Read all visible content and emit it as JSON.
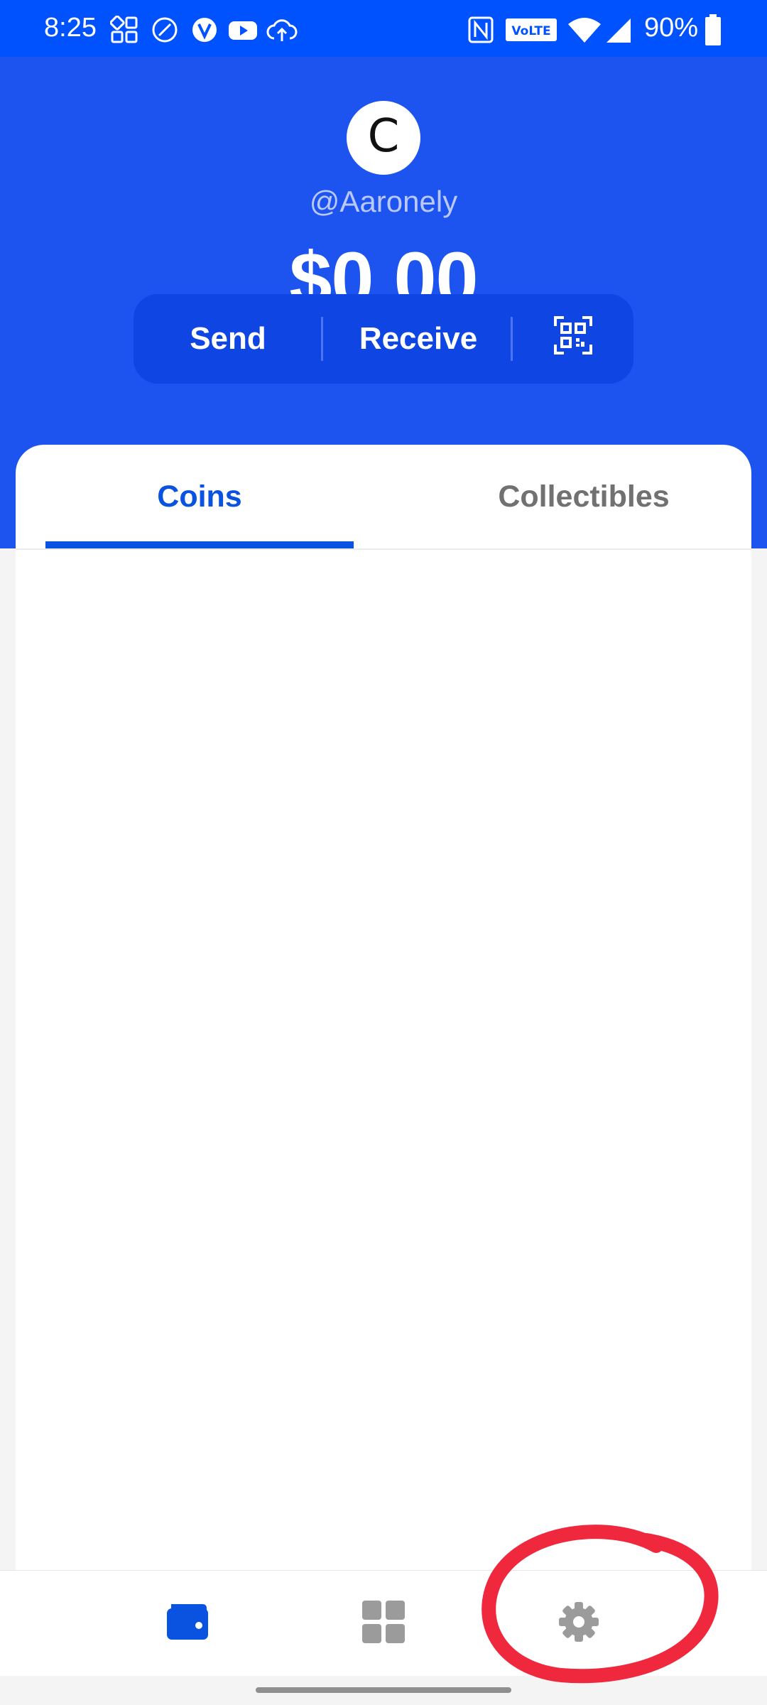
{
  "status_bar": {
    "time": "8:25",
    "battery": "90%",
    "volte_label": "VoLTE",
    "icons": [
      "widgets-icon",
      "circle-slash-icon",
      "v-icon",
      "youtube-icon",
      "cloud-upload-icon",
      "nfc-icon",
      "volte-icon",
      "wifi-icon",
      "signal-icon",
      "battery-icon"
    ]
  },
  "profile": {
    "avatar_letter": "C",
    "username": "@Aaronely",
    "balance": "$0.00"
  },
  "actions": {
    "send_label": "Send",
    "receive_label": "Receive",
    "scan_icon": "qr-scan-icon"
  },
  "tabs": [
    {
      "label": "Coins",
      "active": true
    },
    {
      "label": "Collectibles",
      "active": false
    }
  ],
  "bottom_nav": [
    {
      "name": "wallet-icon",
      "active": true
    },
    {
      "name": "grid-icon",
      "active": false
    },
    {
      "name": "gear-icon",
      "active": false
    }
  ],
  "colors": {
    "header_blue": "#1d54f0",
    "status_blue": "#0052ff",
    "accent": "#0a52e0",
    "annotation_red": "#f0283e"
  }
}
